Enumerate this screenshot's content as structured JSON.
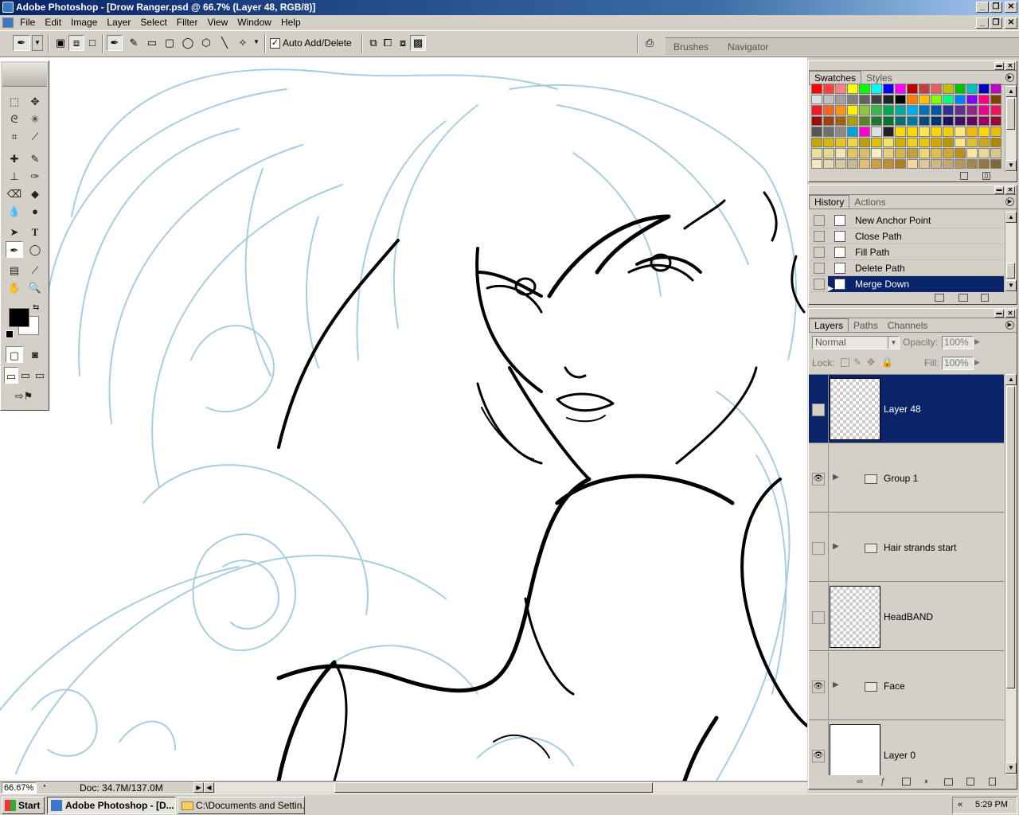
{
  "window": {
    "title": "Adobe Photoshop - [Drow Ranger.psd @ 66.7% (Layer 48, RGB/8)]",
    "controls": [
      "_",
      "❐",
      "✕"
    ]
  },
  "menu": [
    "File",
    "Edit",
    "Image",
    "Layer",
    "Select",
    "Filter",
    "View",
    "Window",
    "Help"
  ],
  "options": {
    "auto_add_delete_label": "Auto Add/Delete",
    "auto_add_delete_checked": true,
    "well_tabs": [
      "Brushes",
      "Navigator"
    ]
  },
  "swatches_palette": {
    "tabs": [
      "Swatches",
      "Styles"
    ],
    "colors": [
      "#ff0000",
      "#ff4040",
      "#ff8080",
      "#ffff00",
      "#00ff00",
      "#00ffff",
      "#0000ff",
      "#ff00ff",
      "#c00000",
      "#c04040",
      "#e06060",
      "#c0c000",
      "#00c000",
      "#00c0c0",
      "#0000c0",
      "#c000c0",
      "#e0e0e0",
      "#c0c0c0",
      "#a0a0a0",
      "#808080",
      "#606060",
      "#404040",
      "#202020",
      "#000000",
      "#ff8000",
      "#ffc000",
      "#80ff00",
      "#00ff80",
      "#0080ff",
      "#8000ff",
      "#ff0080",
      "#804000",
      "#ed1c24",
      "#f26522",
      "#f7941d",
      "#fff200",
      "#8dc63f",
      "#39b54a",
      "#00a651",
      "#00a99d",
      "#00aeef",
      "#0072bc",
      "#0054a6",
      "#2e3192",
      "#662d91",
      "#92278f",
      "#ec008c",
      "#ed145b",
      "#9e0b0f",
      "#a0410d",
      "#a36209",
      "#aba000",
      "#598527",
      "#197b30",
      "#007236",
      "#00746b",
      "#0076a3",
      "#004a80",
      "#003471",
      "#1b1464",
      "#440e62",
      "#630460",
      "#9e005d",
      "#9e0039",
      "#555555",
      "#6e6e6e",
      "#8a8a8a",
      "#00a0e0",
      "#ff00cc",
      "#e0e0e0",
      "#202020",
      "#ffd800",
      "#ffd800",
      "#ffe44d",
      "#ffd200",
      "#f0d000",
      "#ffe680",
      "#f0c000",
      "#ffd800",
      "#e8c000",
      "#c8a800",
      "#d8b800",
      "#e8c820",
      "#f0d840",
      "#c0a000",
      "#e0c000",
      "#f8e060",
      "#d0b000",
      "#f0d020",
      "#e8c800",
      "#d0a800",
      "#b89800",
      "#f8e888",
      "#e0c030",
      "#c8a820",
      "#b08800",
      "#f0e0a0",
      "#e8d890",
      "#f0e8b0",
      "#e0c860",
      "#d8c070",
      "#f8f0c0",
      "#e8d080",
      "#d0b850",
      "#c0a040",
      "#f0d870",
      "#e0c050",
      "#d0a830",
      "#b89020",
      "#f8e8a0",
      "#e8d8a0",
      "#d8c890",
      "#f8e8c0",
      "#e8d8b0",
      "#d8c8a0",
      "#c8b890",
      "#e0c070",
      "#d0a040",
      "#c09030",
      "#b08020",
      "#f0d8a0",
      "#e0c890",
      "#d0b880",
      "#c0a870",
      "#b09860",
      "#a08850",
      "#907840",
      "#806830"
    ],
    "footer_icons": [
      "new-swatch-icon",
      "trash-icon"
    ]
  },
  "history_palette": {
    "tabs": [
      "History",
      "Actions"
    ],
    "items": [
      {
        "label": "New Anchor Point",
        "selected": false
      },
      {
        "label": "Close Path",
        "selected": false
      },
      {
        "label": "Fill Path",
        "selected": false
      },
      {
        "label": "Delete Path",
        "selected": false
      },
      {
        "label": "Merge Down",
        "selected": true
      }
    ]
  },
  "layers_palette": {
    "tabs": [
      "Layers",
      "Paths",
      "Channels"
    ],
    "blend_mode": "Normal",
    "opacity_label": "Opacity:",
    "opacity_value": "100%",
    "lock_label": "Lock:",
    "fill_label": "Fill:",
    "fill_value": "100%",
    "layers": [
      {
        "name": "Layer 48",
        "type": "layer",
        "visible": false,
        "selected": true,
        "thumb": "transparent"
      },
      {
        "name": "Group 1",
        "type": "group",
        "visible": true,
        "selected": false
      },
      {
        "name": "Hair strands start",
        "type": "group",
        "visible": false,
        "selected": false
      },
      {
        "name": "HeadBAND",
        "type": "layer",
        "visible": false,
        "selected": false,
        "thumb": "transparent"
      },
      {
        "name": "Face",
        "type": "group",
        "visible": true,
        "selected": false
      },
      {
        "name": "Layer 0",
        "type": "layer",
        "visible": true,
        "selected": false,
        "thumb": "white"
      }
    ]
  },
  "status": {
    "zoom": "66.67%",
    "doc": "Doc: 34.7M/137.0M"
  },
  "taskbar": {
    "start": "Start",
    "buttons": [
      {
        "label": "Adobe Photoshop - [D...",
        "active": true
      },
      {
        "label": "C:\\Documents and Settin...",
        "active": false
      }
    ],
    "time": "5:29 PM"
  },
  "colors": {
    "selection": "#0a246a",
    "sketch": "#a9cde0",
    "ink": "#000000"
  }
}
